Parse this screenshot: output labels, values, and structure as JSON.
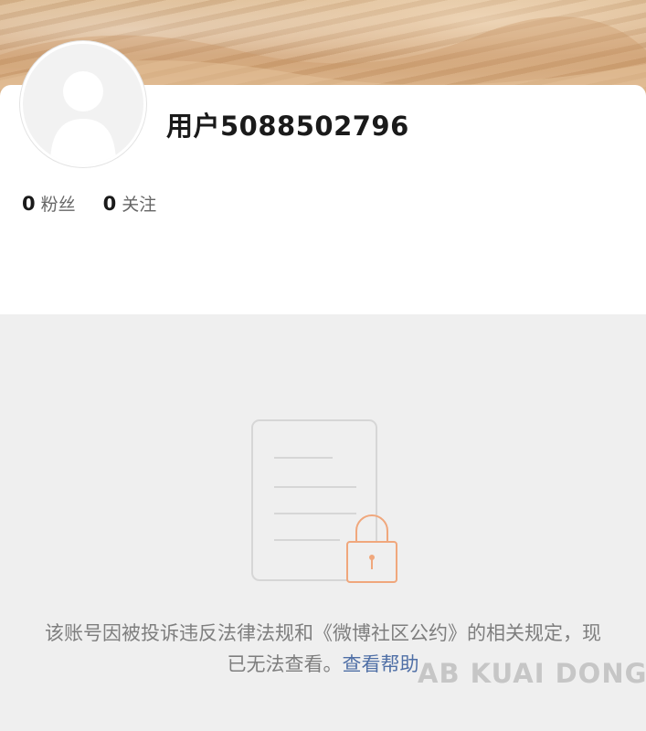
{
  "profile": {
    "username": "用户5088502796",
    "followers_count": "0",
    "followers_label": "粉丝",
    "following_count": "0",
    "following_label": "关注"
  },
  "notice": {
    "text": "该账号因被投诉违反法律法规和《微博社区公约》的相关规定，现已无法查看。",
    "help_link": "查看帮助"
  },
  "watermark": "AB KUAI DONG",
  "colors": {
    "link": "#4f6fa6",
    "lock_icon": "#f0a77c",
    "page_bg": "#efefef"
  },
  "icons": {
    "empty_state": "locked-document-icon",
    "avatar": "default-user-avatar"
  }
}
